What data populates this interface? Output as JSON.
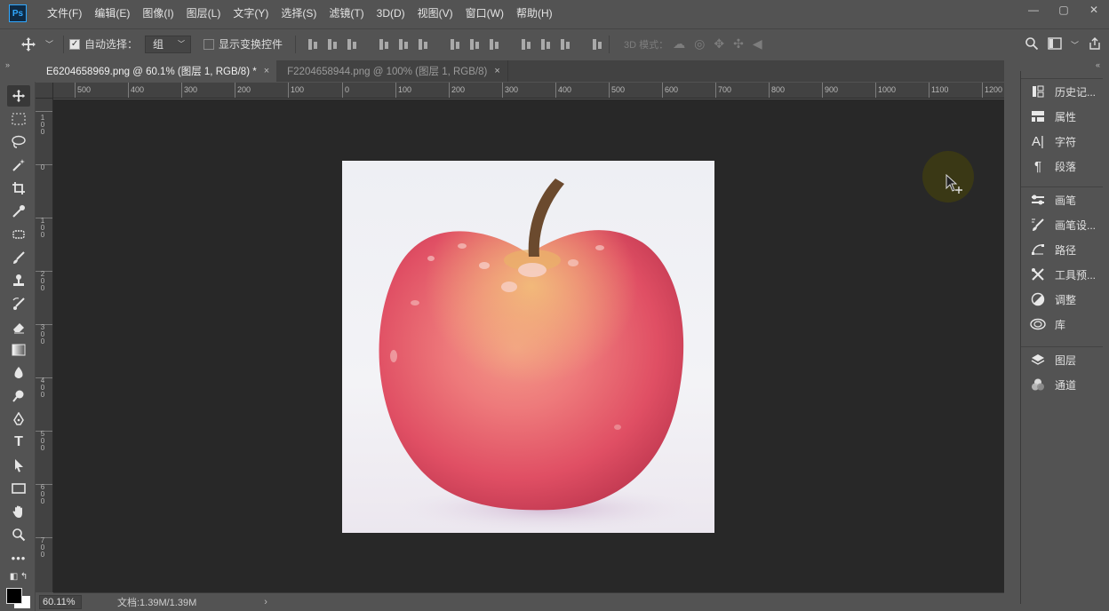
{
  "app": {
    "logo": "Ps"
  },
  "menu": [
    "文件(F)",
    "编辑(E)",
    "图像(I)",
    "图层(L)",
    "文字(Y)",
    "选择(S)",
    "滤镜(T)",
    "3D(D)",
    "视图(V)",
    "窗口(W)",
    "帮助(H)"
  ],
  "window_controls": {
    "minimize": "—",
    "maximize": "▢",
    "close": "✕"
  },
  "options": {
    "auto_select_label": "自动选择：",
    "auto_select_checked": true,
    "auto_select_value": "组",
    "show_transform_label": "显示变换控件",
    "show_transform_checked": false,
    "mode_3d_label": "3D 模式："
  },
  "tabs": [
    {
      "label": "E6204658969.png @ 60.1% (图层 1, RGB/8) *",
      "close": "×",
      "active": true
    },
    {
      "label": "F2204658944.png @ 100% (图层 1, RGB/8)",
      "close": "×",
      "active": false
    }
  ],
  "ruler_top_labels": [
    "500",
    "400",
    "300",
    "200",
    "100",
    "0",
    "100",
    "200",
    "300",
    "400",
    "500",
    "600",
    "700",
    "800",
    "900",
    "1000",
    "1100",
    "1200"
  ],
  "ruler_left_labels": [
    "1\n0\n0",
    "0",
    "1\n0\n0",
    "2\n0\n0",
    "3\n0\n0",
    "4\n0\n0",
    "5\n0\n0",
    "6\n0\n0",
    "7\n0\n0"
  ],
  "document": {
    "content": "red apple with water droplets on white background"
  },
  "status": {
    "zoom": "60.11%",
    "doc_info": "文档:1.39M/1.39M",
    "arrow": "›"
  },
  "panels": {
    "group1": [
      {
        "label": "历史记...",
        "icon": "history-icon"
      },
      {
        "label": "属性",
        "icon": "properties-icon"
      },
      {
        "label": "字符",
        "icon": "character-icon"
      },
      {
        "label": "段落",
        "icon": "paragraph-icon"
      }
    ],
    "group2": [
      {
        "label": "画笔",
        "icon": "brush-icon"
      },
      {
        "label": "画笔设...",
        "icon": "brush-settings-icon"
      },
      {
        "label": "路径",
        "icon": "paths-icon"
      },
      {
        "label": "工具预...",
        "icon": "tool-presets-icon"
      },
      {
        "label": "调整",
        "icon": "adjustments-icon"
      },
      {
        "label": "库",
        "icon": "libraries-icon"
      }
    ],
    "group3": [
      {
        "label": "图层",
        "icon": "layers-icon"
      },
      {
        "label": "通道",
        "icon": "channels-icon"
      }
    ]
  },
  "colors": {
    "foreground": "#000000",
    "background": "#ffffff",
    "accent": "#31a8ff"
  }
}
